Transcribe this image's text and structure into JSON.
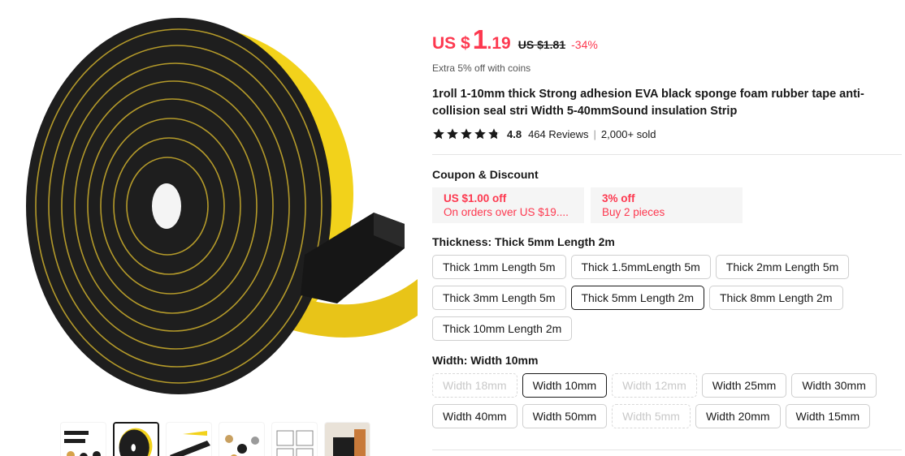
{
  "price": {
    "currency": "US $",
    "integer": "1",
    "decimal": ".19",
    "original": "US $1.81",
    "discount": "-34%"
  },
  "coins_note": "Extra 5% off with coins",
  "title": "1roll 1-10mm thick Strong adhesion EVA black sponge foam rubber tape anti-collision seal stri Width 5-40mmSound insulation Strip",
  "rating": {
    "score": "4.8",
    "stars": 4.8,
    "reviews": "464 Reviews",
    "separator": "|",
    "sold": "2,000+ sold"
  },
  "coupon_section": {
    "label": "Coupon & Discount",
    "coupons": [
      {
        "title": "US $1.00 off",
        "subtitle": "On orders over US $19...."
      },
      {
        "title": "3% off",
        "subtitle": "Buy 2 pieces"
      }
    ]
  },
  "thickness": {
    "label": "Thickness: Thick 5mm Length 2m",
    "options": [
      {
        "label": "Thick 1mm Length 5m",
        "state": "normal"
      },
      {
        "label": "Thick 1.5mmLength 5m",
        "state": "normal"
      },
      {
        "label": "Thick 2mm Length 5m",
        "state": "normal"
      },
      {
        "label": "Thick 3mm Length 5m",
        "state": "normal"
      },
      {
        "label": "Thick 5mm Length 2m",
        "state": "selected"
      },
      {
        "label": "Thick 8mm Length 2m",
        "state": "normal"
      },
      {
        "label": "Thick 10mm Length 2m",
        "state": "normal"
      }
    ]
  },
  "width": {
    "label": "Width: Width 10mm",
    "options": [
      {
        "label": "Width 18mm",
        "state": "disabled"
      },
      {
        "label": "Width 10mm",
        "state": "selected"
      },
      {
        "label": "Width 12mm",
        "state": "disabled"
      },
      {
        "label": "Width 25mm",
        "state": "normal"
      },
      {
        "label": "Width 30mm",
        "state": "normal"
      },
      {
        "label": "Width 40mm",
        "state": "normal"
      },
      {
        "label": "Width 50mm",
        "state": "normal"
      },
      {
        "label": "Width 5mm",
        "state": "disabled"
      },
      {
        "label": "Width 20mm",
        "state": "normal"
      },
      {
        "label": "Width 15mm",
        "state": "normal"
      }
    ]
  },
  "colors": {
    "price_red": "#fd384f",
    "tape_black": "#1e1e1e",
    "tape_yellow": "#f2d21b"
  }
}
